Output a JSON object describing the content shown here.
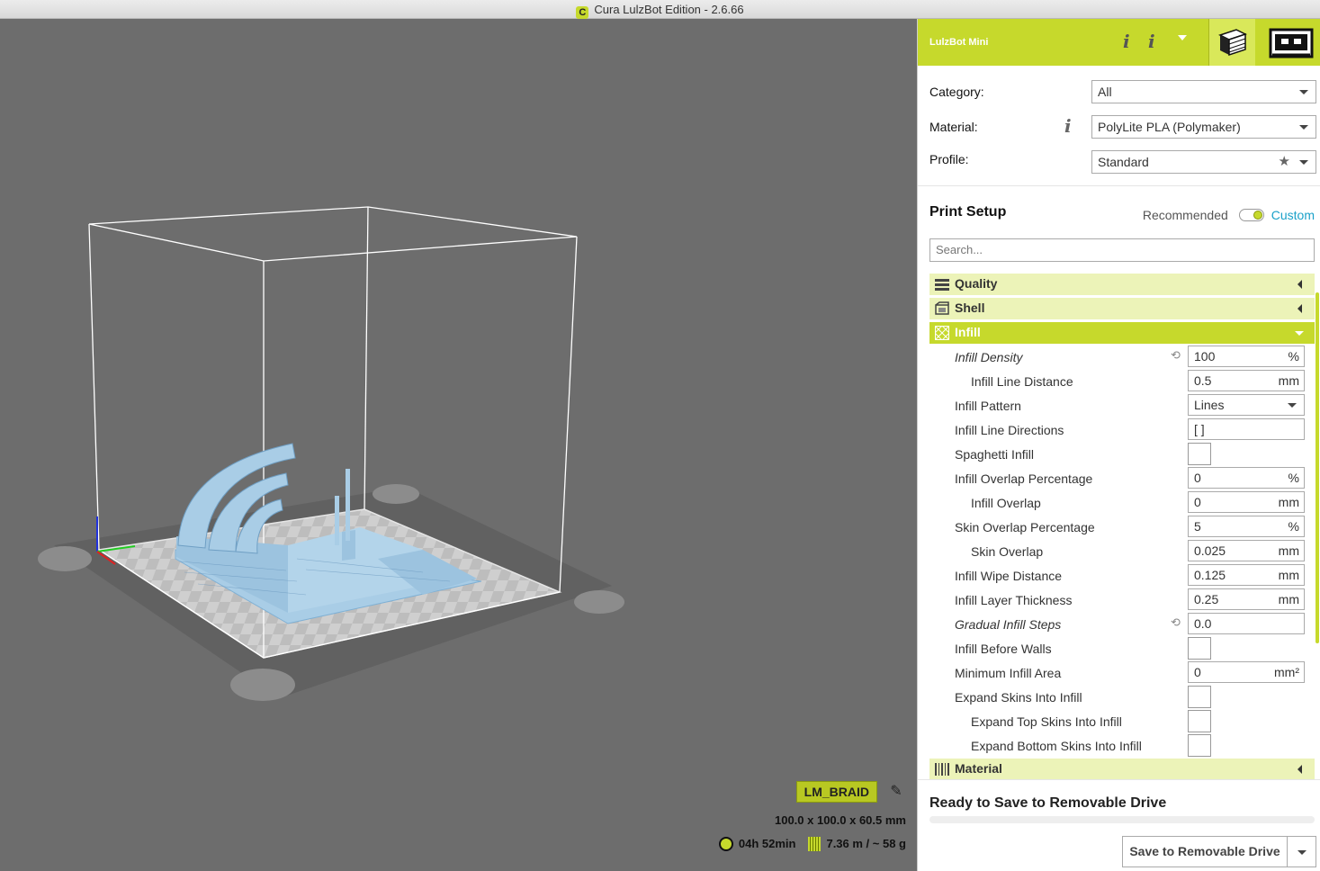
{
  "window": {
    "title": "Cura LulzBot Edition - 2.6.66",
    "app_icon_letter": "C"
  },
  "viewport": {
    "model_name": "LM_BRAID",
    "dimensions": "100.0 x 100.0 x 60.5 mm",
    "print_time": "04h 52min",
    "material_usage": "7.36 m / ~ 58 g",
    "model_color": "#a9cde6"
  },
  "header": {
    "machine_name": "LulzBot Mini",
    "accent_color": "#c6d92c",
    "info_glyph": "i"
  },
  "top_settings": {
    "category_label": "Category:",
    "category_value": "All",
    "material_label": "Material:",
    "material_value": "PolyLite PLA (Polymaker)",
    "profile_label": "Profile:",
    "profile_value": "Standard"
  },
  "print_setup": {
    "title": "Print Setup",
    "mode_recommended": "Recommended",
    "mode_custom": "Custom",
    "search_placeholder": "Search...",
    "categories": {
      "quality": "Quality",
      "shell": "Shell",
      "infill": "Infill",
      "material": "Material"
    },
    "infill_settings": [
      {
        "label": "Infill Density",
        "value": "100",
        "unit": "%"
      },
      {
        "label": "Infill Line Distance",
        "value": "0.5",
        "unit": "mm"
      },
      {
        "label": "Infill Pattern",
        "value": "Lines",
        "unit": ""
      },
      {
        "label": "Infill Line Directions",
        "value": "[ ]",
        "unit": ""
      },
      {
        "label": "Spaghetti Infill",
        "value": "",
        "unit": ""
      },
      {
        "label": "Infill Overlap Percentage",
        "value": "0",
        "unit": "%"
      },
      {
        "label": "Infill Overlap",
        "value": "0",
        "unit": "mm"
      },
      {
        "label": "Skin Overlap Percentage",
        "value": "5",
        "unit": "%"
      },
      {
        "label": "Skin Overlap",
        "value": "0.025",
        "unit": "mm"
      },
      {
        "label": "Infill Wipe Distance",
        "value": "0.125",
        "unit": "mm"
      },
      {
        "label": "Infill Layer Thickness",
        "value": "0.25",
        "unit": "mm"
      },
      {
        "label": "Gradual Infill Steps",
        "value": "0.0",
        "unit": ""
      },
      {
        "label": "Infill Before Walls",
        "value": "",
        "unit": ""
      },
      {
        "label": "Minimum Infill Area",
        "value": "0",
        "unit": "mm²"
      },
      {
        "label": "Expand Skins Into Infill",
        "value": "",
        "unit": ""
      },
      {
        "label": "Expand Top Skins Into Infill",
        "value": "",
        "unit": ""
      },
      {
        "label": "Expand Bottom Skins Into Infill",
        "value": "",
        "unit": ""
      }
    ]
  },
  "save": {
    "status": "Ready to Save to Removable Drive",
    "button_label": "Save to Removable Drive"
  }
}
